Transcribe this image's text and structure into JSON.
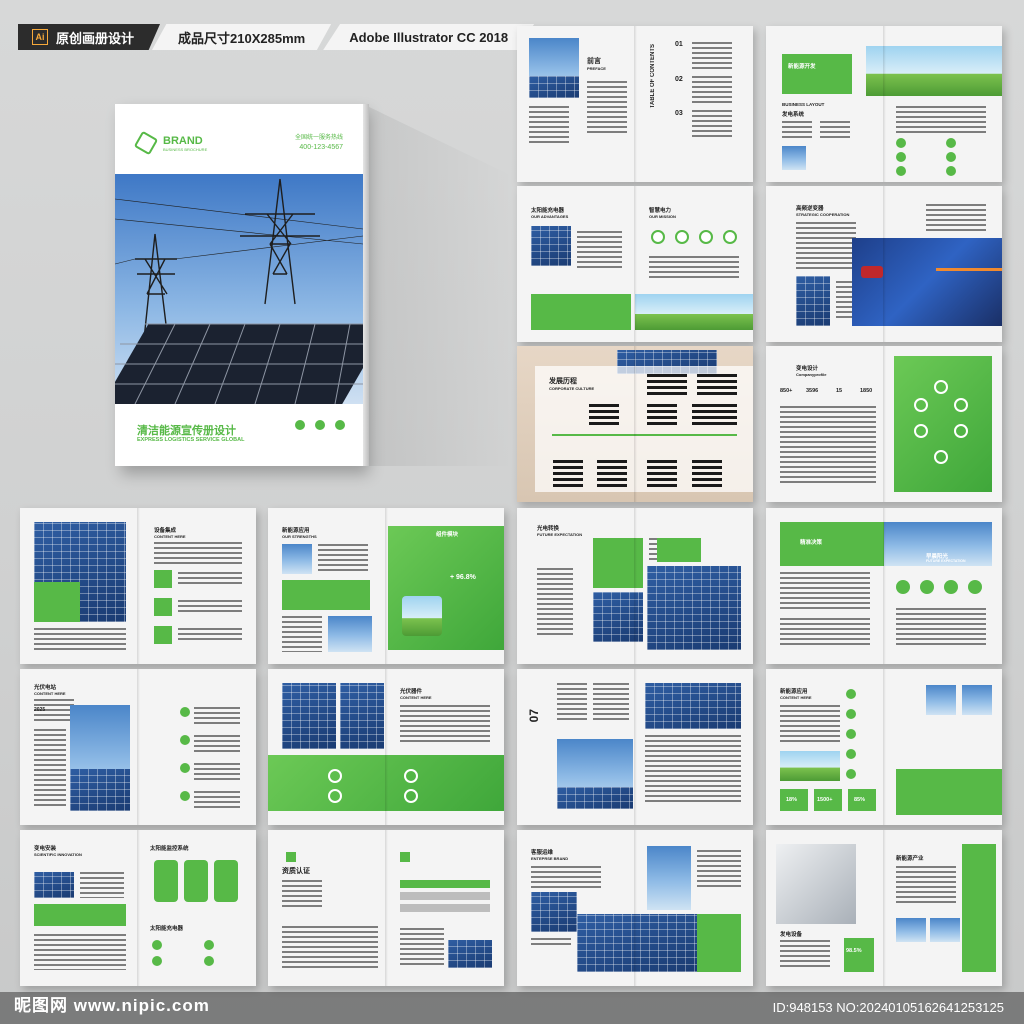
{
  "header": {
    "software_badge": "Ai",
    "label_1": "原创画册设计",
    "label_2": "成品尺寸210X285mm",
    "label_3": "Adobe Illustrator CC 2018"
  },
  "cover": {
    "brand": "BRAND",
    "brand_sub": "BUSINESS BROCHURE",
    "phone_label": "全国统一服务热线",
    "phone": "400-123-4567",
    "title": "清洁能源宣传册设计",
    "subtitle": "EXPRESS LOGISTICS SERVICE GLOBAL"
  },
  "spreads": {
    "s1": {
      "title": "前言",
      "sub": "PREFACE",
      "contents": "TABLE OF CONTENTS",
      "items": [
        "01",
        "02",
        "03"
      ]
    },
    "s2": {
      "title": "新能源开发",
      "layout": "BUSINESS LAYOUT",
      "right": "发电系统"
    },
    "s3": {
      "left": "太阳能充电器",
      "left_sub": "OUR ADVANTAGES",
      "right": "智慧电力",
      "right_sub": "OUR MISSION"
    },
    "s4": {
      "title": "高频逆变器",
      "sub": "STRATEGIC COOPERATION"
    },
    "s5": {
      "title": "发展历程",
      "sub": "CORPORATE CULTURE"
    },
    "s6": {
      "title": "变电设计",
      "sub": "Companyprofile",
      "stats": [
        "850+",
        "3596",
        "15",
        "1850"
      ]
    },
    "s7": {
      "title": "设备集成",
      "sub": "CONTENT HERE"
    },
    "s8": {
      "title": "新能源应用",
      "sub": "OUR STRENGTHS",
      "right": "组件模块",
      "stat": "+ 96.8%"
    },
    "s9": {
      "title": "光电转换",
      "sub": "FUTURE EXPECTATION"
    },
    "s10": {
      "title": "精准决策",
      "right": "早晨阳光",
      "right_sub": "FUTURE EXPECTATION"
    },
    "s11": {
      "title": "光伏电站",
      "sub": "CONTENT HERE",
      "year": "2025"
    },
    "s12": {
      "title": "光伏器件",
      "sub": "CONTENT HERE"
    },
    "s13": {
      "num": "07"
    },
    "s14": {
      "title": "新能源应用",
      "sub": "CONTENT HERE",
      "stats": [
        "18%",
        "1500+",
        "85%"
      ]
    },
    "s15": {
      "title": "变电安装",
      "sub": "SCIENTIFIC INNOVATION",
      "right": "太阳能监控系统",
      "right2": "太阳能充电器"
    },
    "s16": {
      "title": "资质认证"
    },
    "s17": {
      "title": "客服运维",
      "sub": "ENTEPRSE BRAND"
    },
    "s18": {
      "title": "新能源产业",
      "right": "发电设备",
      "stat": "98.5%"
    }
  },
  "footer": {
    "watermark": "昵图网 www.nipic.com",
    "id": "ID:948153 NO:20240105162641253125"
  },
  "colors": {
    "accent": "#57b947",
    "dark": "#2c2c2c",
    "blue": "#2f5ea3"
  }
}
